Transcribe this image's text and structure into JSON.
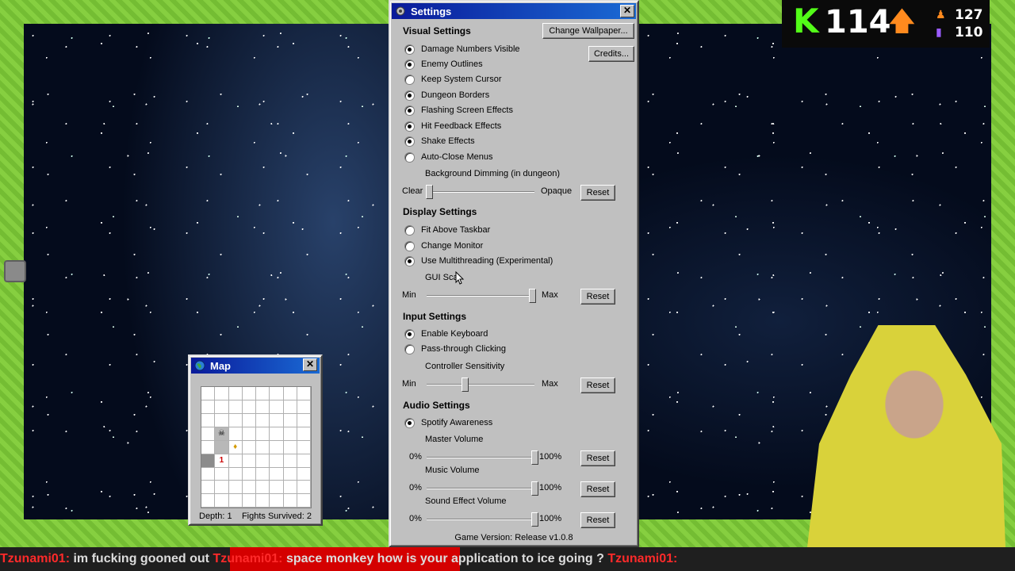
{
  "settings": {
    "title": "Settings",
    "change_wallpaper": "Change Wallpaper...",
    "credits": "Credits...",
    "visual": {
      "heading": "Visual Settings",
      "options": [
        {
          "label": "Damage Numbers Visible",
          "checked": true
        },
        {
          "label": "Enemy Outlines",
          "checked": true
        },
        {
          "label": "Keep System Cursor",
          "checked": false
        },
        {
          "label": "Dungeon Borders",
          "checked": true
        },
        {
          "label": "Flashing Screen Effects",
          "checked": true
        },
        {
          "label": "Hit Feedback Effects",
          "checked": true
        },
        {
          "label": "Shake Effects",
          "checked": true
        },
        {
          "label": "Auto-Close Menus",
          "checked": false
        }
      ],
      "dimming": {
        "label": "Background Dimming (in dungeon)",
        "min": "Clear",
        "max": "Opaque",
        "value": 0.02,
        "reset": "Reset"
      }
    },
    "display": {
      "heading": "Display Settings",
      "options": [
        {
          "label": "Fit Above Taskbar",
          "checked": false
        },
        {
          "label": "Change Monitor",
          "checked": false
        },
        {
          "label": "Use Multithreading (Experimental)",
          "checked": true
        }
      ],
      "gui_scale": {
        "label": "GUI Sca",
        "min": "Min",
        "max": "Max",
        "value": 0.98,
        "reset": "Reset"
      }
    },
    "input": {
      "heading": "Input Settings",
      "options": [
        {
          "label": "Enable Keyboard",
          "checked": true
        },
        {
          "label": "Pass-through Clicking",
          "checked": false
        }
      ],
      "controller": {
        "label": "Controller Sensitivity",
        "min": "Min",
        "max": "Max",
        "value": 0.35,
        "reset": "Reset"
      }
    },
    "audio": {
      "heading": "Audio Settings",
      "options": [
        {
          "label": "Spotify Awareness",
          "checked": true
        }
      ],
      "master": {
        "label": "Master Volume",
        "min": "0%",
        "max": "100%",
        "value": 1.0,
        "reset": "Reset"
      },
      "music": {
        "label": "Music Volume",
        "min": "0%",
        "max": "100%",
        "value": 1.0,
        "reset": "Reset"
      },
      "sfx": {
        "label": "Sound Effect Volume",
        "min": "0%",
        "max": "100%",
        "value": 1.0,
        "reset": "Reset"
      }
    },
    "version": "Game Version: Release v1.0.8"
  },
  "map": {
    "title": "Map",
    "depth": "Depth: 1",
    "fights": "Fights Survived: 2",
    "number_cell": "1"
  },
  "overlay": {
    "viewer_count": "114",
    "stat_1": "127",
    "stat_2": "110",
    "kick_letter": "K",
    "accent": "#53fc18"
  },
  "chat": {
    "user": "Tzunami01:",
    "msg_1": "im fucking gooned out",
    "msg_2": "space monkey how is your application to ice going ?"
  }
}
